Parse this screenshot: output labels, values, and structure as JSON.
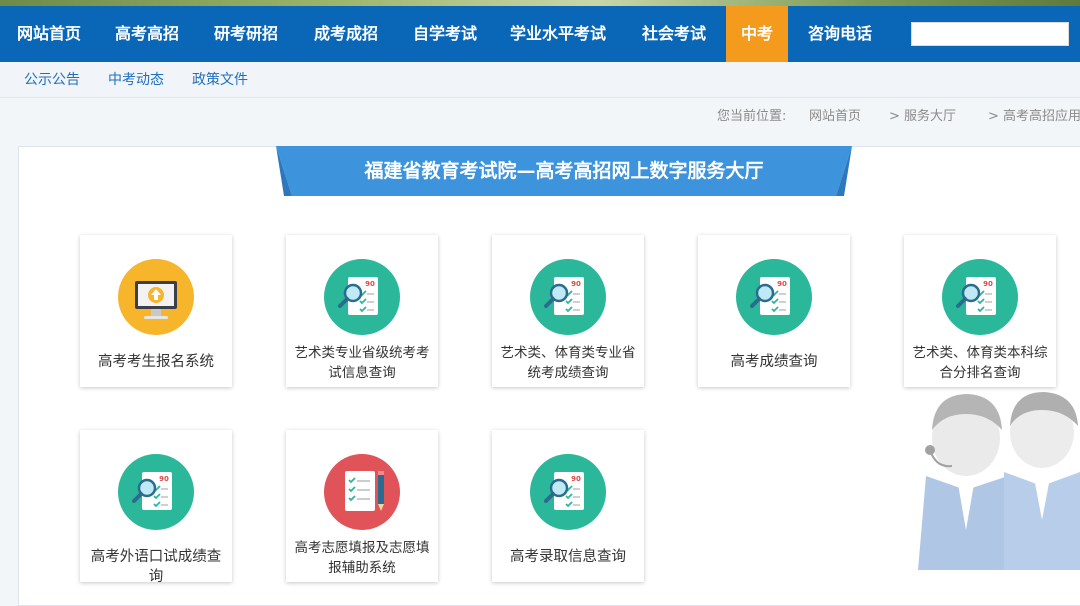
{
  "nav": {
    "items": [
      {
        "label": "网站首页"
      },
      {
        "label": "高考高招"
      },
      {
        "label": "研考研招"
      },
      {
        "label": "成考成招"
      },
      {
        "label": "自学考试"
      },
      {
        "label": "学业水平考试"
      },
      {
        "label": "社会考试"
      },
      {
        "label": "中考"
      },
      {
        "label": "咨询电话"
      }
    ],
    "active_item": "中考",
    "search": {
      "value": "",
      "placeholder": ""
    }
  },
  "subnav": {
    "items": [
      {
        "label": "公示公告"
      },
      {
        "label": "中考动态"
      },
      {
        "label": "政策文件"
      }
    ]
  },
  "breadcrumb": {
    "prefix": "您当前位置:",
    "items": [
      {
        "label": "网站首页"
      },
      {
        "label": "> 服务大厅"
      },
      {
        "label": "> 高考高招应用"
      }
    ]
  },
  "banner": {
    "title": "福建省教育考试院—高考高招网上数字服务大厅"
  },
  "services": [
    {
      "label": "高考考生报名系统",
      "icon": "computer-upload-icon"
    },
    {
      "label": "艺术类专业省级统考考试信息查询",
      "icon": "score-sheet-search-icon"
    },
    {
      "label": "艺术类、体育类专业省统考成绩查询",
      "icon": "score-sheet-search-icon"
    },
    {
      "label": "高考成绩查询",
      "icon": "score-sheet-search-icon"
    },
    {
      "label": "艺术类、体育类本科综合分排名查询",
      "icon": "score-sheet-search-icon"
    },
    {
      "label": "高考外语口试成绩查询",
      "icon": "score-sheet-search-icon"
    },
    {
      "label": "高考志愿填报及志愿填报辅助系统",
      "icon": "form-pencil-icon"
    },
    {
      "label": "高考录取信息查询",
      "icon": "score-sheet-search-icon"
    }
  ],
  "colors": {
    "nav_bg": "#0a66b7",
    "nav_active": "#f49a1c",
    "teal_icon": "#2bb79a",
    "yellow_icon": "#f6b52b",
    "red_icon": "#e05358",
    "banner": "#3d93dc"
  }
}
